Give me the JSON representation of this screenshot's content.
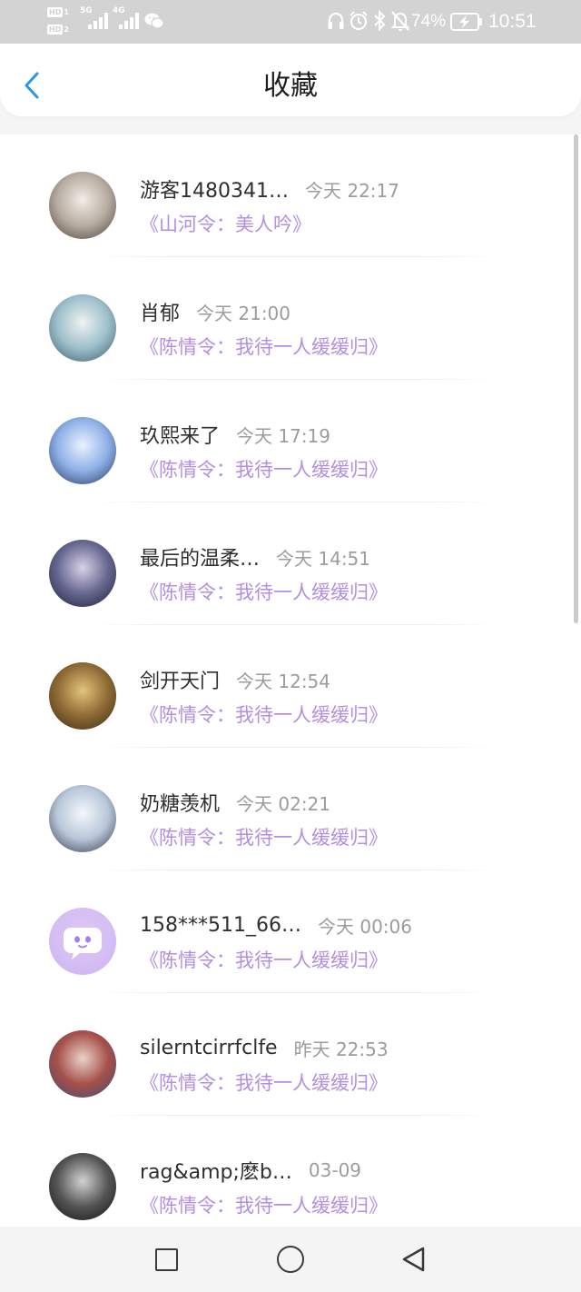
{
  "status_bar": {
    "sim1_label": "HD",
    "sim1_num": "1",
    "sim2_label": "HD",
    "sim2_num": "2",
    "net1": "5G",
    "net2": "4G",
    "battery": "74%",
    "time": "10:51",
    "icons": [
      "signal-icon",
      "signal-icon",
      "wechat-icon",
      "headphones-icon",
      "alarm-icon",
      "bluetooth-icon",
      "bell-mute-icon",
      "battery-charging-icon"
    ]
  },
  "header": {
    "title": "收藏",
    "back_icon": "chevron-left-icon"
  },
  "colors": {
    "accent": "#2b97e4",
    "work": "#b48ee0",
    "name": "#2f2f2f",
    "time": "#9c9c9c"
  },
  "list": {
    "items": [
      {
        "name": "游客1480341…",
        "time": "今天 22:17",
        "work": "《山河令：美人吟》",
        "avatar_colors": [
          "#f1ede7",
          "#b7aca0",
          "#4a3f37"
        ]
      },
      {
        "name": "肖郁",
        "time": "今天 21:00",
        "work": "《陈情令：我待一人缓缓归》",
        "avatar_colors": [
          "#f0f2f1",
          "#9dbfcb",
          "#3b586a"
        ]
      },
      {
        "name": "玖熙来了",
        "time": "今天 17:19",
        "work": "《陈情令：我待一人缓缓归》",
        "avatar_colors": [
          "#e9f2ff",
          "#8eb0e6",
          "#27335d"
        ]
      },
      {
        "name": "最后的温柔…",
        "time": "今天 14:51",
        "work": "《陈情令：我待一人缓缓归》",
        "avatar_colors": [
          "#d8d2e8",
          "#66678f",
          "#1b1c32"
        ]
      },
      {
        "name": "剑开天门",
        "time": "今天 12:54",
        "work": "《陈情令：我待一人缓缓归》",
        "avatar_colors": [
          "#e3c47c",
          "#8e6a34",
          "#392916"
        ]
      },
      {
        "name": "奶糖羡机",
        "time": "今天 02:21",
        "work": "《陈情令：我待一人缓缓归》",
        "avatar_colors": [
          "#f4f7fb",
          "#b8c7da",
          "#2e3240"
        ]
      },
      {
        "name": "158***511_66…",
        "time": "今天 00:06",
        "work": "《陈情令：我待一人缓缓归》",
        "avatar_colors": [
          "#dcc8f5",
          "#d5bff3",
          "#cdb3f1"
        ],
        "avatar_icon": "chat-bubble-icon"
      },
      {
        "name": "silerntcirrfclfe",
        "time": "昨天 22:53",
        "work": "《陈情令：我待一人缓缓归》",
        "avatar_colors": [
          "#ead3c9",
          "#a6504a",
          "#3e4b73"
        ]
      },
      {
        "name": "rag&amp;麽b…",
        "time": "03-09",
        "work": "《陈情令：我待一人缓缓归》",
        "avatar_colors": [
          "#d2d2d2",
          "#555555",
          "#111111"
        ]
      }
    ]
  },
  "nav": {
    "icons": [
      "square-recent-icon",
      "circle-home-icon",
      "triangle-back-icon"
    ]
  }
}
